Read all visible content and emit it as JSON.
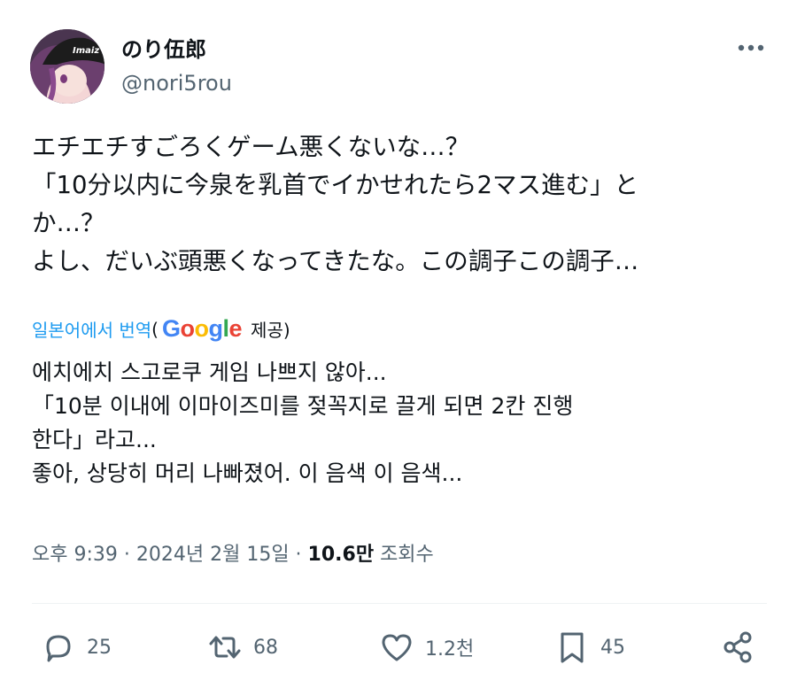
{
  "user": {
    "display_name": "のり伍郎",
    "handle": "@nori5rou",
    "avatar_text": "Imaiz"
  },
  "tweet": {
    "lines": [
      "エチエチすごろくゲーム悪くないな…？",
      "「10分以内に今泉を乳首でイかせれたら2マス進む」と",
      "か…？",
      "よし、だいぶ頭悪くなってきたな。この調子この調子…"
    ]
  },
  "translation": {
    "link_label": "일본어에서 번역",
    "open_paren": "(",
    "google": [
      "G",
      "o",
      "o",
      "g",
      "l",
      "e"
    ],
    "provided": "제공)",
    "lines": [
      "에치에치 스고로쿠 게임 나쁘지 않아...",
      "「10분 이내에 이마이즈미를 젖꼭지로 끌게 되면 2칸 진행",
      "한다」라고...",
      "좋아, 상당히 머리 나빠졌어. 이 음색 이 음색..."
    ]
  },
  "meta": {
    "time": "오후 9:39",
    "sep1": " · ",
    "date": "2024년 2월 15일",
    "sep2": " · ",
    "views": "10.6만",
    "views_label": " 조회수"
  },
  "actions": {
    "replies": "25",
    "reposts": "68",
    "likes": "1.2천",
    "bookmarks": "45"
  },
  "colors": {
    "link": "#1d9bf0",
    "secondary_text": "#536471",
    "google_colors": [
      "#4285F4",
      "#EA4335",
      "#FBBC05",
      "#4285F4",
      "#34A853",
      "#EA4335"
    ]
  }
}
